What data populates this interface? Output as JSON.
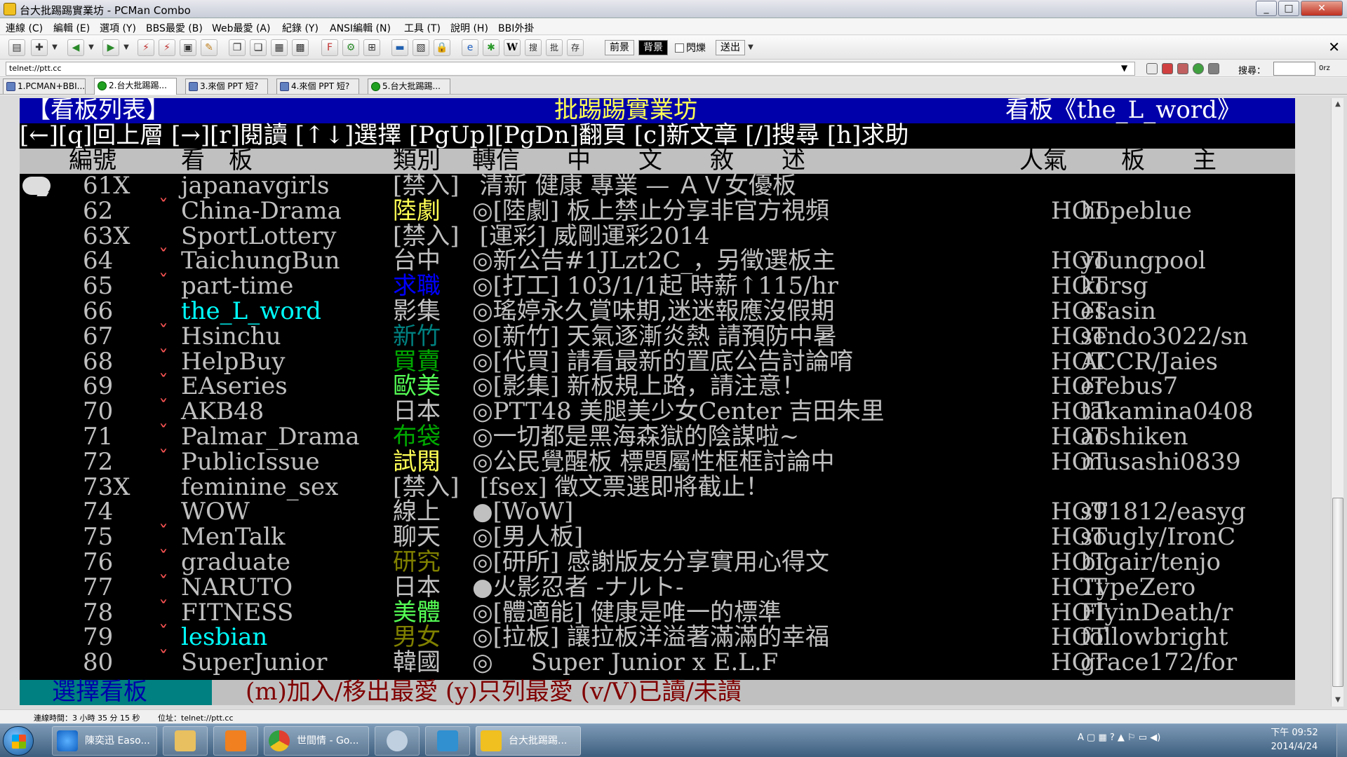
{
  "window": {
    "title": "台大批踢踢實業坊 - PCMan Combo",
    "min": "_",
    "max": "□",
    "close": "✕"
  },
  "menu": [
    "連線 (C)",
    "編輯 (E)",
    "選項 (Y)",
    "BBS最愛 (B)",
    "Web最愛 (A)",
    "紀錄 (Y)",
    "ANSI編輯 (N)",
    "工具 (T)",
    "說明 (H)",
    "BBI外掛"
  ],
  "toolbar": {
    "fg": "前景",
    "bg": "背景",
    "blink": "閃爍",
    "send": "送出",
    "w": "W",
    "search_btn": "搜",
    "ptt_btn": "批",
    "save_btn": "存"
  },
  "address": {
    "value": "telnet://ptt.cc"
  },
  "search": {
    "label": "搜尋：",
    "sel": "0rz"
  },
  "tabs": [
    "1.PCMAN+BBI...",
    "2.台大批踢踢...",
    "3.來個 PPT 短?",
    "4.來個 PPT 短?",
    "5.台大批踢踢..."
  ],
  "terminal": {
    "header_left": "【看板列表】",
    "header_center": "批踢踢實業坊",
    "header_right": "看板《the_L_word》",
    "help": "[←][q]回上層 [→][r]閱讀 [↑↓]選擇 [PgUp][PgDn]翻頁 [c]新文章 [/]搜尋 [h]求助",
    "col_num": "編號",
    "col_board": "看　板",
    "col_cat": "類別",
    "col_fwd": "轉信",
    "col_desc": "中　　文　　敘　　述",
    "col_pop": "人氣",
    "col_mods": "板　　主",
    "footer_left": "選擇看板",
    "footer_msg": "(m)加入/移出最愛 (y)只列最愛 (v/V)已讀/未讀",
    "rows": [
      {
        "num": "61X",
        "flag": "",
        "board": "japanavgirls",
        "cat": "[禁入]",
        "desc": " 清新 健康 專業 — ＡＶ女優板",
        "pop": "",
        "mods": ""
      },
      {
        "num": "62",
        "flag": "ˇ",
        "board": "China-Drama",
        "cat": "陸劇",
        "desc": "◎[陸劇] 板上禁止分享非官方視頻",
        "pop": "HOT",
        "mods": "hopeblue"
      },
      {
        "num": "63X",
        "flag": "",
        "board": "SportLottery",
        "cat": "[禁入]",
        "desc": " [運彩] 威剛運彩2014",
        "pop": "",
        "mods": ""
      },
      {
        "num": "64",
        "flag": "ˇ",
        "board": "TaichungBun",
        "cat": "台中",
        "desc": "◎新公告#1JLzt2C_，另徵選板主",
        "pop": "HOT",
        "mods": "youngpool"
      },
      {
        "num": "65",
        "flag": "ˇ",
        "board": "part-time",
        "cat": "求職",
        "desc": "◎[打工] 103/1/1起 時薪↑115/hr",
        "pop": "HOT",
        "mods": "korsg"
      },
      {
        "num": "66",
        "flag": "",
        "board": "the_L_word",
        "cat": "影集",
        "desc": "◎瑤婷永久賞味期,迷迷報應沒假期",
        "pop": "HOT",
        "mods": "esasin"
      },
      {
        "num": "67",
        "flag": "ˇ",
        "board": "Hsinchu",
        "cat": "新竹",
        "desc": "◎[新竹] 天氣逐漸炎熱 請預防中暑",
        "pop": "HOT",
        "mods": "sendo3022/sn"
      },
      {
        "num": "68",
        "flag": "ˇ",
        "board": "HelpBuy",
        "cat": "買賣",
        "desc": "◎[代買] 請看最新的置底公告討論唷",
        "pop": "HOT",
        "mods": "ACCR/Jaies"
      },
      {
        "num": "69",
        "flag": "ˇ",
        "board": "EAseries",
        "cat": "歐美",
        "desc": "◎[影集] 新板規上路，請注意！",
        "pop": "HOT",
        "mods": "erebus7"
      },
      {
        "num": "70",
        "flag": "ˇ",
        "board": "AKB48",
        "cat": "日本",
        "desc": "◎PTT48 美腿美少女Center 吉田朱里",
        "pop": "HOT",
        "mods": "takamina0408"
      },
      {
        "num": "71",
        "flag": "ˇ",
        "board": "Palmar_Drama",
        "cat": "布袋",
        "desc": "◎一切都是黑海森獄的陰謀啦~",
        "pop": "HOT",
        "mods": "aoshiken"
      },
      {
        "num": "72",
        "flag": "ˇ",
        "board": "PublicIssue",
        "cat": "試閱",
        "desc": "◎公民覺醒板 標題屬性框框討論中",
        "pop": "HOT",
        "mods": "musashi0839"
      },
      {
        "num": "73X",
        "flag": "",
        "board": "feminine_sex",
        "cat": "[禁入]",
        "desc": " [fsex] 徵文票選即將截止！",
        "pop": "",
        "mods": ""
      },
      {
        "num": "74",
        "flag": "",
        "board": "WOW",
        "cat": "線上",
        "desc": "●[WoW]",
        "pop": "HOT",
        "mods": "s91812/easyg"
      },
      {
        "num": "75",
        "flag": "ˇ",
        "board": "MenTalk",
        "cat": "聊天",
        "desc": "◎[男人板]",
        "pop": "HOT",
        "mods": "sougly/IronC"
      },
      {
        "num": "76",
        "flag": "ˇ",
        "board": "graduate",
        "cat": "研究",
        "desc": "◎[研所] 感謝版友分享實用心得文",
        "pop": "HOT",
        "mods": "bigair/tenjo"
      },
      {
        "num": "77",
        "flag": "ˇ",
        "board": "NARUTO",
        "cat": "日本",
        "desc": "●火影忍者 -ナルト-",
        "pop": "HOT",
        "mods": "TypeZero"
      },
      {
        "num": "78",
        "flag": "ˇ",
        "board": "FITNESS",
        "cat": "美體",
        "desc": "◎[體適能] 健康是唯一的標準",
        "pop": "HOT",
        "mods": "FlyinDeath/r"
      },
      {
        "num": "79",
        "flag": "ˇ",
        "board": "lesbian",
        "cat": "男女",
        "desc": "◎[拉板] 讓拉板洋溢著滿滿的幸福",
        "pop": "HOT",
        "mods": "followbright"
      },
      {
        "num": "80",
        "flag": "ˇ",
        "board": "SuperJunior",
        "cat": "韓國",
        "desc": "◎     Super Junior x E.L.F",
        "pop": "HOT",
        "mods": "grace172/for"
      }
    ]
  },
  "colors": {
    "cat": [
      "#c0c0c0",
      "#ffff55",
      "#c0c0c0",
      "#c0c0c0",
      "#0000ff",
      "#c0c0c0",
      "#008080",
      "#00aa00",
      "#55ff55",
      "#c0c0c0",
      "#00aa00",
      "#ffff55",
      "#c0c0c0",
      "#c0c0c0",
      "#c0c0c0",
      "#808000",
      "#c0c0c0",
      "#55ff55",
      "#808000",
      "#c0c0c0"
    ],
    "board_cyan": [
      5,
      18
    ]
  },
  "status": {
    "conn_time": "連線時間：3 小時 35 分 15 秒",
    "address": "位址：telnet://ptt.cc"
  },
  "taskbar": {
    "items": [
      "陳奕迅 Easo...",
      "",
      "",
      "世間情 - Go...",
      "",
      "",
      "台大批踢踢..."
    ],
    "tray": "A ▢ ▦ ? ▲ ⚐ ▭ ◀)",
    "time": "下午 09:52",
    "date": "2014/4/24"
  }
}
